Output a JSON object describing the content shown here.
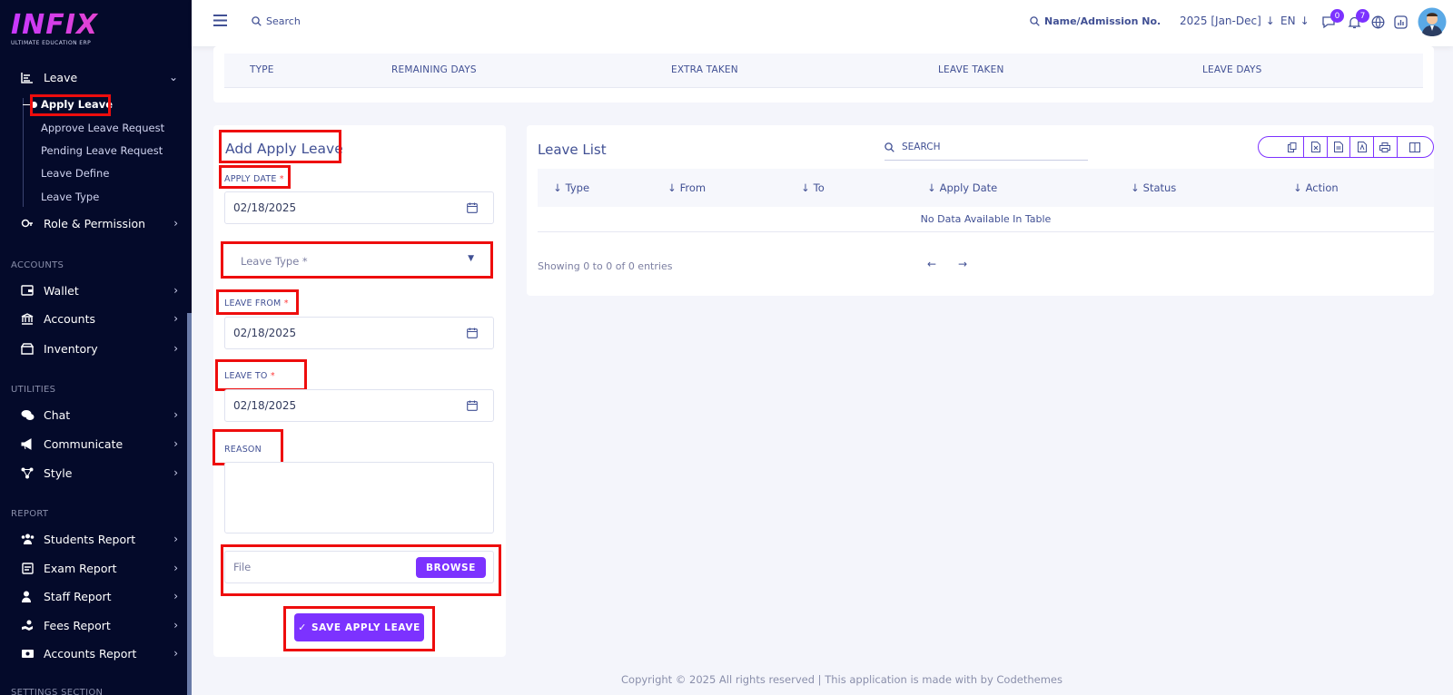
{
  "brand": {
    "name": "INFIX",
    "tagline": "ULTIMATE EDUCATION ERP"
  },
  "sidebar": {
    "leave_label": "Leave",
    "sub_items": [
      "Apply Leave",
      "Approve Leave Request",
      "Pending Leave Request",
      "Leave Define",
      "Leave Type"
    ],
    "role_label": "Role & Permission",
    "sections": {
      "accounts": "ACCOUNTS",
      "utilities": "UTILITIES",
      "report": "REPORT",
      "settings": "SETTINGS SECTION"
    },
    "accounts_items": [
      "Wallet",
      "Accounts",
      "Inventory"
    ],
    "utilities_items": [
      "Chat",
      "Communicate",
      "Style"
    ],
    "report_items": [
      "Students Report",
      "Exam Report",
      "Staff Report",
      "Fees Report",
      "Accounts Report"
    ]
  },
  "header": {
    "search_placeholder": "Search",
    "student_search": "Name/Admission No.",
    "session": "2025 [Jan-Dec]",
    "language": "EN",
    "chat_badge": "0",
    "notif_badge": "7"
  },
  "leave_summary": {
    "columns": [
      "TYPE",
      "REMAINING DAYS",
      "EXTRA TAKEN",
      "LEAVE TAKEN",
      "LEAVE DAYS"
    ]
  },
  "form": {
    "title": "Add Apply Leave",
    "apply_date_label": "APPLY DATE",
    "apply_date": "02/18/2025",
    "leave_type_placeholder": "Leave Type *",
    "leave_from_label": "LEAVE FROM",
    "leave_from": "02/18/2025",
    "leave_to_label": "LEAVE TO",
    "leave_to": "02/18/2025",
    "reason_label": "REASON",
    "file_placeholder": "File",
    "browse_label": "BROWSE",
    "save_label": "SAVE APPLY LEAVE",
    "required_mark": "*"
  },
  "leave_list": {
    "title": "Leave List",
    "search_placeholder": "SEARCH",
    "columns": [
      "Type",
      "From",
      "To",
      "Apply Date",
      "Status",
      "Action"
    ],
    "empty_text": "No Data Available In Table",
    "info": "Showing 0 to 0 of 0 entries"
  },
  "footer": {
    "copyright": "Copyright © 2025 All rights reserved | This application is made with by Codethemes"
  },
  "colors": {
    "accent": "#7c32ff",
    "sidebar_bg": "#040a2a",
    "highlight": "#ee0d0d"
  }
}
